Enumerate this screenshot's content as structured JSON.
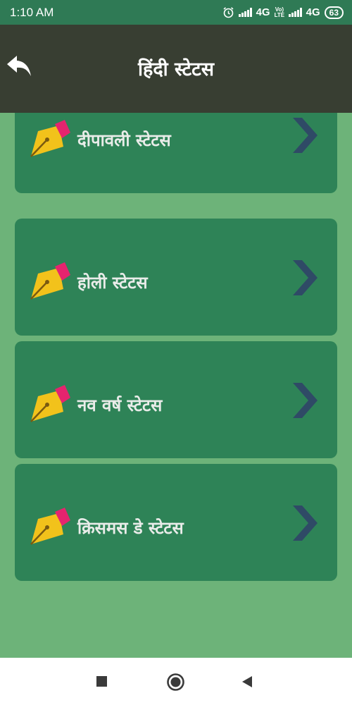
{
  "status_bar": {
    "time": "1:10 AM",
    "network_1": "4G",
    "volte_top": "Vo)",
    "volte_bottom": "LTE",
    "network_2": "4G",
    "battery": "63"
  },
  "header": {
    "title": "हिंदी स्टेटस",
    "back_icon": "back-arrow-icon"
  },
  "categories": [
    {
      "label": "दीपावली स्टेटस",
      "icon": "pen-nib-icon"
    },
    {
      "label": "होली स्टेटस",
      "icon": "pen-nib-icon"
    },
    {
      "label": "नव वर्ष स्टेटस",
      "icon": "pen-nib-icon"
    },
    {
      "label": "क्रिसमस डे स्टेटस",
      "icon": "pen-nib-icon"
    }
  ],
  "nav": [
    "recents-square-icon",
    "home-circle-icon",
    "back-triangle-icon"
  ],
  "colors": {
    "status_bar": "#2f7a55",
    "app_bar": "#383e32",
    "background": "#6db379",
    "card": "#2e8357",
    "chevron": "#2f4a66",
    "pen_nib": "#f2c21b",
    "pen_cap": "#e5246e"
  }
}
